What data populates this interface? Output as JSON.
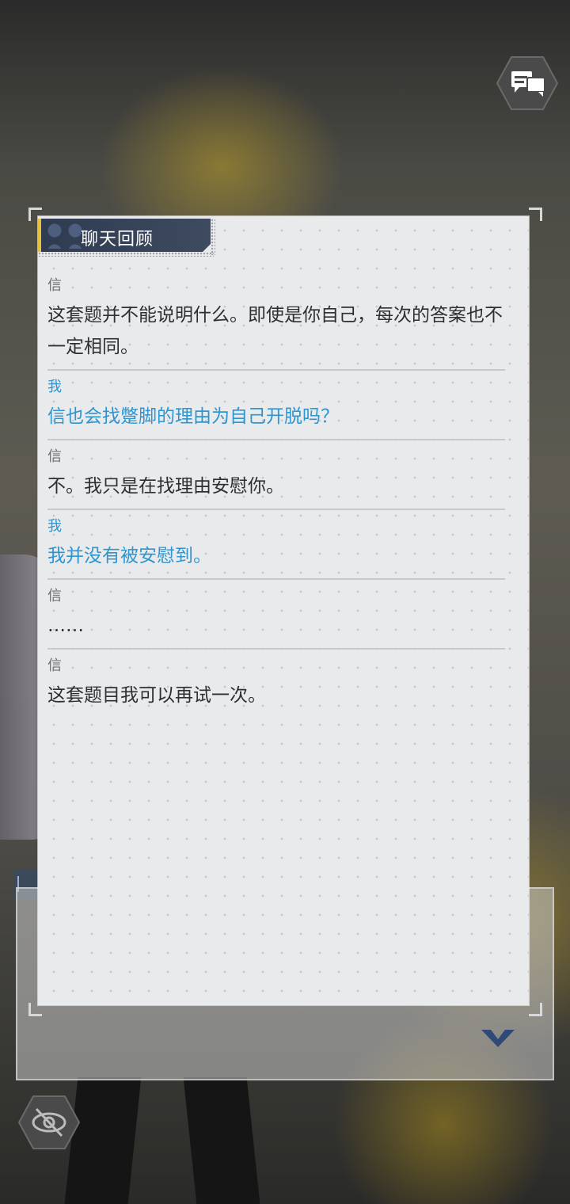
{
  "panel": {
    "title": "聊天回顾"
  },
  "messages": [
    {
      "speaker": "信",
      "text": "这套题并不能说明什么。即使是你自己，每次的答案也不一定相同。",
      "self": false
    },
    {
      "speaker": "我",
      "text": "信也会找蹩脚的理由为自己开脱吗？",
      "self": true
    },
    {
      "speaker": "信",
      "text": "不。我只是在找理由安慰你。",
      "self": false
    },
    {
      "speaker": "我",
      "text": "我并没有被安慰到。",
      "self": true
    },
    {
      "speaker": "信",
      "text": "……",
      "self": false
    },
    {
      "speaker": "信",
      "text": "这套题目我可以再试一次。",
      "self": false
    }
  ],
  "controls": {
    "chat_log_icon": "chat-bubbles-icon",
    "hide_ui_icon": "eye-off-icon",
    "next_icon": "chevron-down-icon"
  },
  "colors": {
    "self_text": "#2d95cf",
    "other_text": "#2d2f33",
    "title_bar": "#2f3b50",
    "title_accent": "#e9c23a"
  }
}
